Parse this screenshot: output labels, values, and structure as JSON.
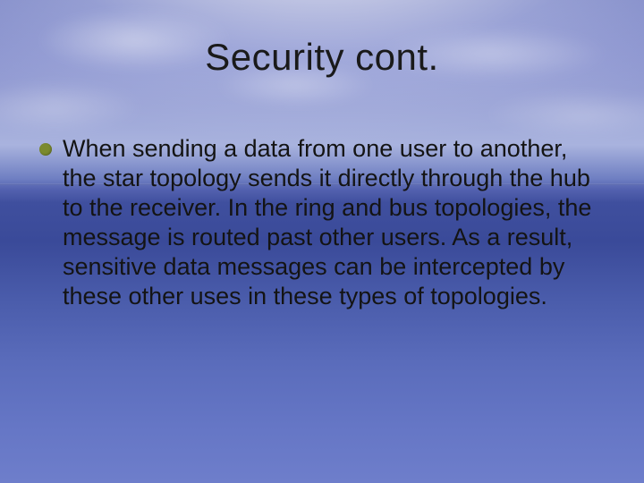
{
  "slide": {
    "title": "Security cont.",
    "bullets": [
      {
        "text": "When sending a data from one user to another, the star topology sends it directly through the hub to the receiver. In the ring and bus topologies, the message is routed past other users. As a result, sensitive data messages can be intercepted by these other uses in these types of topologies."
      }
    ]
  }
}
